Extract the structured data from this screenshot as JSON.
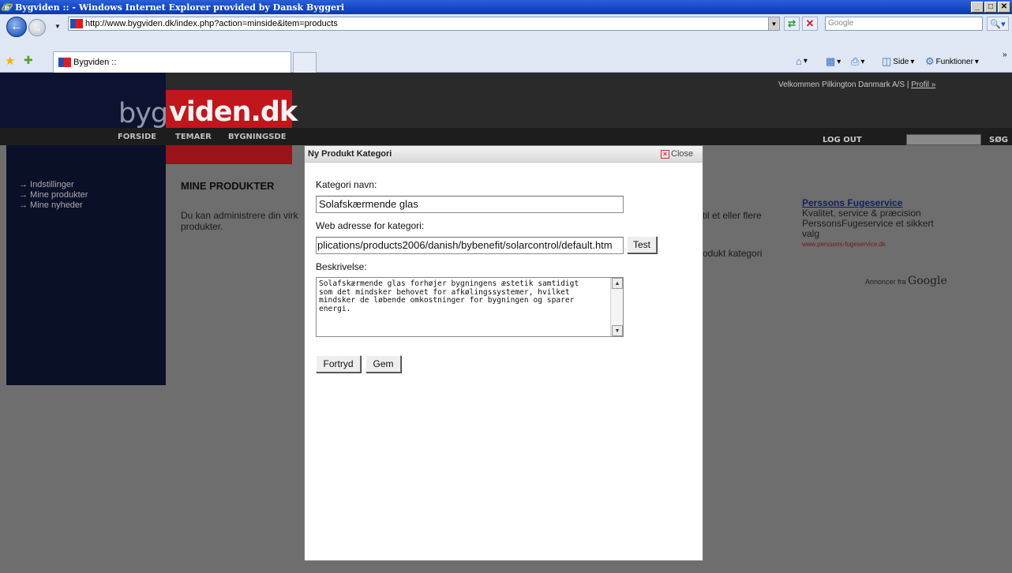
{
  "window": {
    "title": "Bygviden :: - Windows Internet Explorer provided by Dansk Byggeri",
    "buttons": [
      "_",
      "□",
      "✕"
    ]
  },
  "toolbar": {
    "url": "http://www.bygviden.dk/index.php?action=minside&item=products",
    "search_placeholder": "Google",
    "tab_title": "Bygviden ::",
    "commands": {
      "side_label": "Side",
      "funktioner_label": "Funktioner"
    }
  },
  "site": {
    "logo_left": "byg",
    "logo_right": "viden.dk",
    "nav": [
      "FORSIDE",
      "TEMAER",
      "BYGNINGSDE"
    ],
    "welcome_text": "Velkommen Pilkington Danmark A/S |",
    "profile_link": "Profil »",
    "logout_label": "LOG OUT",
    "search_label": "SØG"
  },
  "sidebar": {
    "items": [
      {
        "label": "→ Indstillinger"
      },
      {
        "label": "→ Mine produkter"
      },
      {
        "label": "→ Mine nyheder"
      }
    ]
  },
  "content": {
    "title": "MINE PRODUKTER",
    "text": "Du kan administrere din virk produkter.",
    "right_line1": "til et eller flere",
    "right_line2": "odukt kategori"
  },
  "ad": {
    "title": "Perssons Fugeservice",
    "line1": "Kvalitet, service & præcision",
    "line2": "PerssonsFugeservice et sikkert",
    "line3": "valg",
    "url": "www.perssons-fugeservice.dk",
    "annoncer_label": "Annoncer fra",
    "google_label": "Google"
  },
  "modal": {
    "title": "Ny Produkt Kategori",
    "close_label": "Close",
    "name_label": "Kategori navn:",
    "name_value": "Solafskærmende glas",
    "url_label": "Web adresse for kategori:",
    "url_value": "plications/products2006/danish/bybenefit/solarcontrol/default.htm",
    "test_label": "Test",
    "desc_label": "Beskrivelse:",
    "desc_value": "Solafskærmende glas forhøjer bygningens æstetik samtidigt\nsom det mindsker behovet for afkølingssystemer, hvilket\nmindsker de løbende omkostninger for bygningen og sparer\nenergi.",
    "cancel_label": "Fortryd",
    "save_label": "Gem"
  }
}
